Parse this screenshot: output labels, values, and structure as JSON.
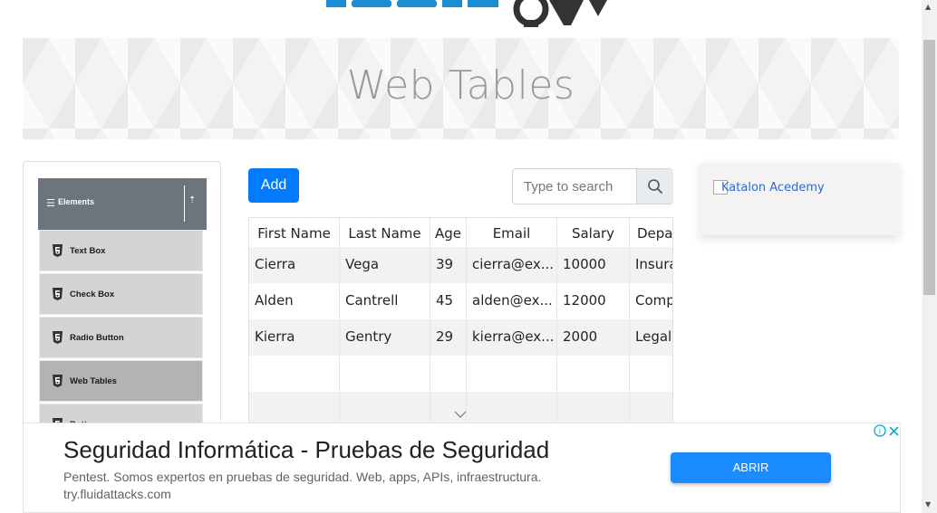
{
  "banner": {
    "title": "Web Tables"
  },
  "sidebar": {
    "group_title": "Elements",
    "items": [
      {
        "label": "Text Box"
      },
      {
        "label": "Check Box"
      },
      {
        "label": "Radio Button"
      },
      {
        "label": "Web Tables",
        "active": true
      },
      {
        "label": "Buttons"
      }
    ]
  },
  "toolbar": {
    "add_label": "Add",
    "search_placeholder": "Type to search"
  },
  "table": {
    "headers": [
      "First Name",
      "Last Name",
      "Age",
      "Email",
      "Salary",
      "Depar"
    ],
    "rows": [
      [
        "Cierra",
        "Vega",
        "39",
        "cierra@ex...",
        "10000",
        "Insura"
      ],
      [
        "Alden",
        "Cantrell",
        "45",
        "alden@ex...",
        "12000",
        "Comp"
      ],
      [
        "Kierra",
        "Gentry",
        "29",
        "kierra@ex...",
        "2000",
        "Legal"
      ]
    ]
  },
  "side_ad": {
    "alt_text": "Katalon Acedemy"
  },
  "bottom_ad": {
    "title": "Seguridad Informática - Pruebas de Seguridad",
    "description": "Pentest. Somos expertos en pruebas de seguridad. Web, apps, APIs, infraestructura.",
    "url": "try.fluidattacks.com",
    "cta_label": "ABRIR"
  },
  "colors": {
    "primary": "#007bff",
    "cta": "#1a8cff",
    "sidebar_header": "#6c757d",
    "logo": "#1b8dd5"
  }
}
